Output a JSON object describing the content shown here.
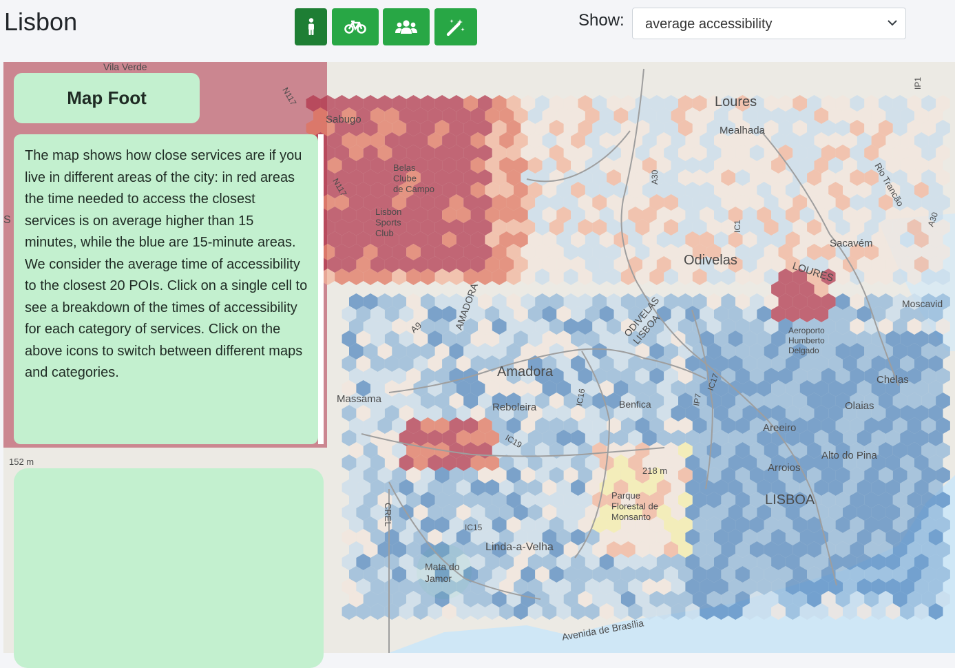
{
  "app": {
    "title": "Lisbon"
  },
  "mode_buttons": [
    {
      "icon": "walking-person-icon",
      "active": true
    },
    {
      "icon": "bicycle-icon",
      "active": false
    },
    {
      "icon": "users-group-icon",
      "active": false
    },
    {
      "icon": "magic-wand-icon",
      "active": false
    }
  ],
  "show": {
    "label": "Show:",
    "selected": "average accessibility"
  },
  "panel": {
    "title": "Map Foot",
    "description": "The map shows how close services are if you live in different areas of the city: in red areas the time needed to access the closest services is on average higher than 15 minutes, while the blue are 15-minute areas. We consider the average time of accessibility to the closest 20 POIs. Click on a single cell to see a breakdown of the times of accessibility for each category of services. Click on the above icons to switch between different maps and categories."
  },
  "map": {
    "place_labels": {
      "vila_verde": "Vila Verde",
      "sabugo": "Sabugo",
      "belas_clube": "Belas\nClube\nde Campo",
      "lisbon_sports": "Lisbon\nSports\nClub",
      "loures_town": "Loures",
      "mealhada": "Mealhada",
      "sacavem": "Sacavém",
      "loures_district": "LOURES",
      "moscavide": "Moscavid",
      "odivelas": "Odivelas",
      "odivelas_lisboa": "ODIVELAS\nLISBOA",
      "amadora_district": "AMADORA",
      "amadora": "Amadora",
      "massama": "Massama",
      "reboleira": "Reboleira",
      "benfica": "Benfica",
      "aeroporto": "Aeroporto\nHumberto\nDelgado",
      "chelas": "Chelas",
      "olaias": "Olaias",
      "areeiro": "Areeiro",
      "alto_do_pina": "Alto do Pina",
      "arroios": "Arroios",
      "lisboa": "LISBOA",
      "parque": "Parque\nFlorestal de\nMonsanto",
      "linda_a_velha": "Linda-a-Velha",
      "mata_do_jamor": "Mata do\nJamor",
      "avenida_brasilia": "Avenida de Brasília",
      "rio_trancao": "Rio Trancão",
      "elev_152": "152 m",
      "elev_218": "218 m",
      "road_n117": "N117",
      "road_n117b": "N117",
      "road_a9": "A9",
      "road_a30": "A30",
      "road_ic1": "IC1",
      "road_ip1": "IP1",
      "road_a30b": "A30",
      "road_ic16": "IC16",
      "road_ic19": "IC19",
      "road_ic17": "IC17",
      "road_ip7": "IP7",
      "road_crel": "CREL",
      "road_ic15": "IC15",
      "edge_s": "S"
    },
    "accessibility_colors": {
      "high_time": "#b0334a",
      "mid_high": "#e0735c",
      "mid": "#f2b49a",
      "neutral": "#f3e6dc",
      "light_blue": "#c7dceb",
      "blue": "#8db5d8",
      "dark_blue": "#4f86bf",
      "yellow": "#f5efa9",
      "water": "#cfe7f6"
    }
  }
}
